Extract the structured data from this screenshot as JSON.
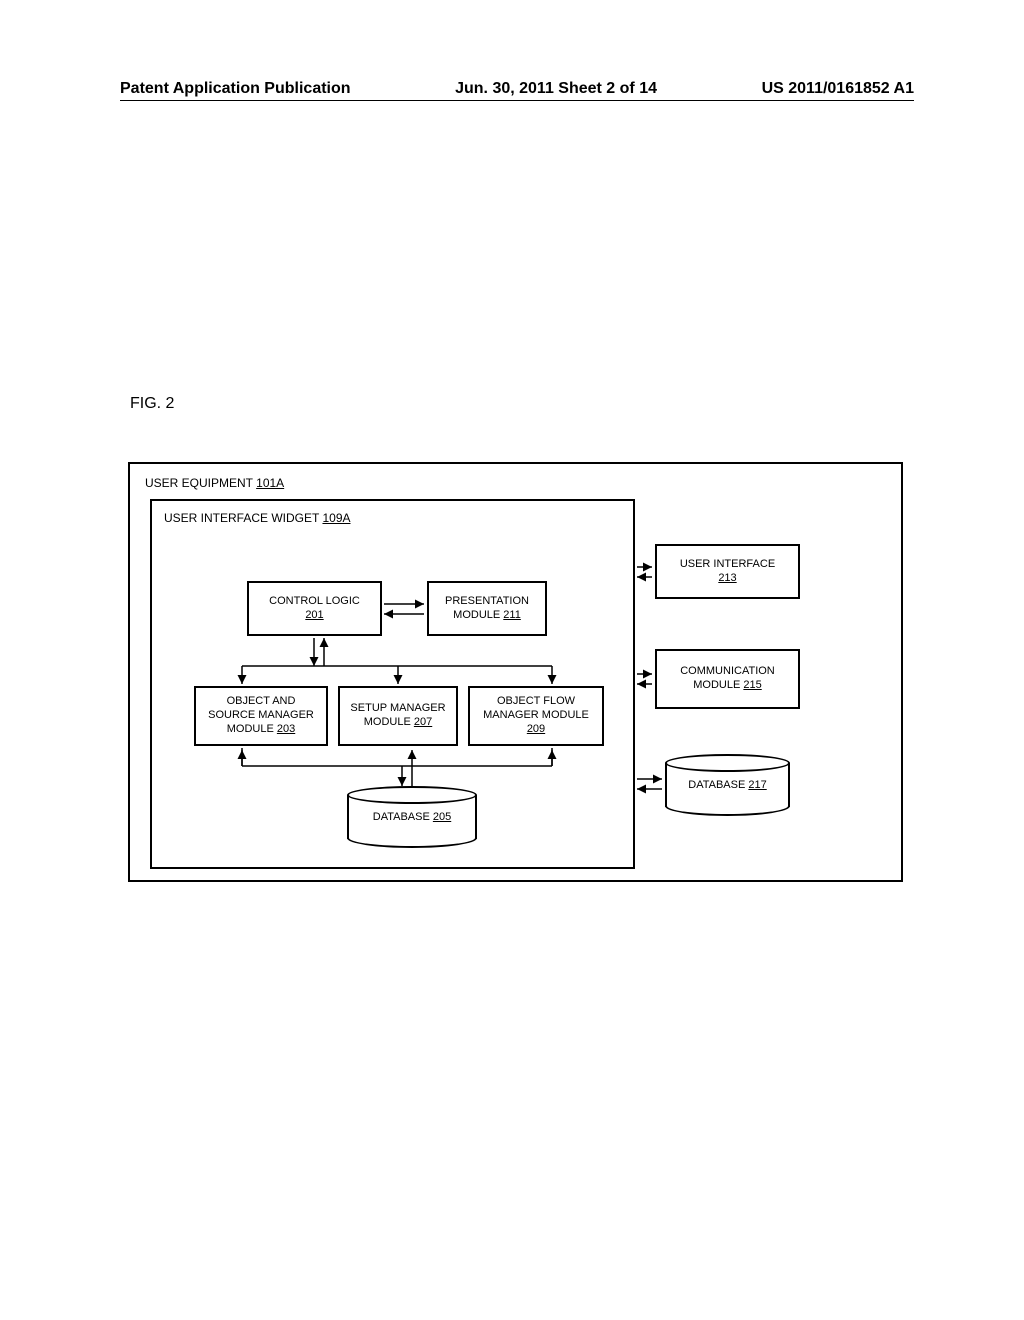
{
  "header": {
    "left": "Patent Application Publication",
    "center": "Jun. 30, 2011  Sheet 2 of 14",
    "right": "US 2011/0161852 A1"
  },
  "figure_label": "FIG. 2",
  "outer": {
    "title": "USER EQUIPMENT ",
    "ref": "101A"
  },
  "widget": {
    "title": "USER INTERFACE WIDGET ",
    "ref": "109A"
  },
  "modules": {
    "control": {
      "line1": "CONTROL LOGIC",
      "ref": "201"
    },
    "presentation": {
      "line1": "PRESENTATION",
      "line2": "MODULE ",
      "ref": "211"
    },
    "object_source": {
      "line1": "OBJECT AND",
      "line2": "SOURCE MANAGER",
      "line3": "MODULE ",
      "ref": "203"
    },
    "setup": {
      "line1": "SETUP MANAGER",
      "line2": "MODULE ",
      "ref": "207"
    },
    "flow": {
      "line1": "OBJECT FLOW",
      "line2": "MANAGER MODULE",
      "ref": "209"
    },
    "ui": {
      "line1": "USER INTERFACE",
      "ref": "213"
    },
    "comm": {
      "line1": "COMMUNICATION",
      "line2": "MODULE ",
      "ref": "215"
    }
  },
  "databases": {
    "db205": {
      "label": "DATABASE ",
      "ref": "205"
    },
    "db217": {
      "label": "DATABASE ",
      "ref": "217"
    }
  }
}
